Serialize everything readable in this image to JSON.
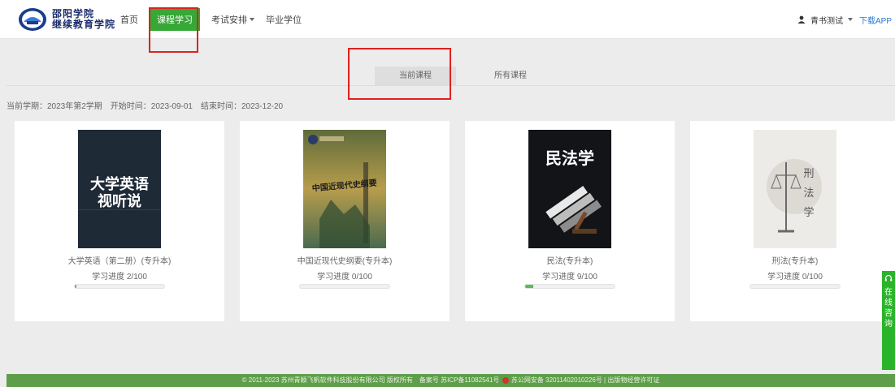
{
  "header": {
    "logo_line1": "邵阳学院",
    "logo_line2": "继续教育学院",
    "nav": [
      {
        "label": "首页",
        "active": false,
        "dropdown": false
      },
      {
        "label": "课程学习",
        "active": true,
        "dropdown": false
      },
      {
        "label": "考试安排",
        "active": false,
        "dropdown": true
      },
      {
        "label": "毕业学位",
        "active": false,
        "dropdown": false
      }
    ],
    "user_name": "青书测试",
    "download_app": "下载APP"
  },
  "subtabs": {
    "current": "当前课程",
    "all": "所有课程"
  },
  "term_info": "当前学期：2023年第2学期　开始时间：2023-09-01　结束时间：2023-12-20",
  "courses": [
    {
      "title": "大学英语（第二册）(专升本)",
      "progress_label": "学习进度 2/100",
      "progress": 2,
      "cover_text": [
        "大学英语",
        "视听说"
      ]
    },
    {
      "title": "中国近现代史纲要(专升本)",
      "progress_label": "学习进度 0/100",
      "progress": 0,
      "cover_text": [
        "中国近现代史纲要"
      ]
    },
    {
      "title": "民法(专升本)",
      "progress_label": "学习进度 9/100",
      "progress": 9,
      "cover_text": [
        "民法学"
      ]
    },
    {
      "title": "刑法(专升本)",
      "progress_label": "学习进度 0/100",
      "progress": 0,
      "cover_text": [
        "刑",
        "法",
        "学"
      ]
    }
  ],
  "footer": {
    "copyright": "© 2011-2023 苏州青颖飞帆软件科技股份有限公司 版权所有　备案号 苏ICP备11082541号",
    "police": "苏公网安备 32011402010226号 | 出版物经营许可证"
  },
  "chat_widget": {
    "chars": [
      "在",
      "线",
      "咨",
      "询"
    ]
  },
  "colors": {
    "accent": "#36a836",
    "link": "#2a78d2",
    "footer": "#5e9e4a",
    "highlight": "#e02020"
  }
}
